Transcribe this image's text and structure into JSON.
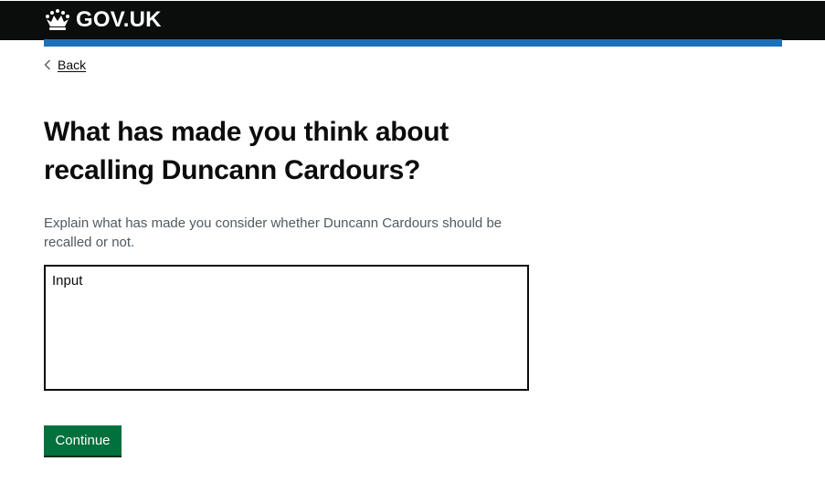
{
  "header": {
    "logo_text": "GOV.UK",
    "logo_icon": "crown-icon",
    "background_color": "#0b0c0c",
    "accent_bar_color": "#1d70b8"
  },
  "navigation": {
    "back_label": "Back",
    "back_icon": "chevron-left-icon"
  },
  "main": {
    "heading": "What has made you think about recalling Duncann Cardours?",
    "hint": "Explain what has made you consider whether Duncann Cardours should be recalled or not.",
    "textarea": {
      "value": "",
      "placeholder": "Input"
    },
    "continue_label": "Continue",
    "continue_color": "#00703c"
  }
}
